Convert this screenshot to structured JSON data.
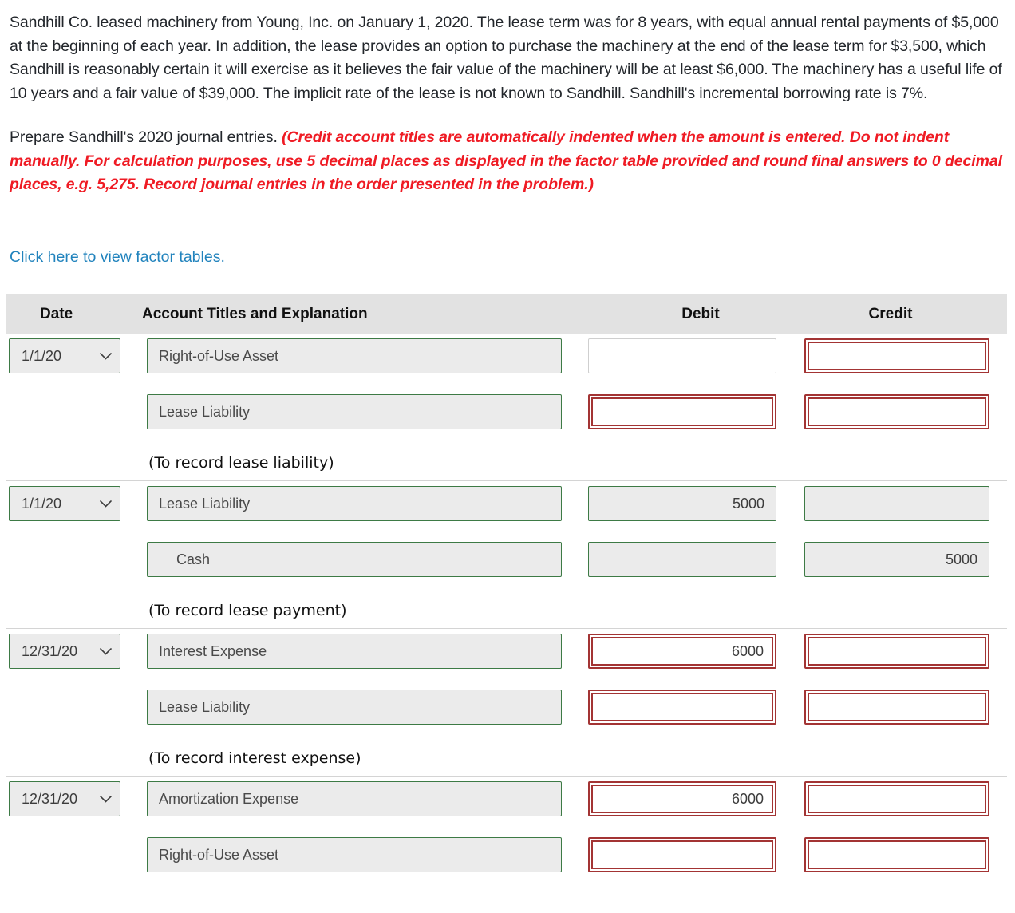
{
  "problem": {
    "paragraph1": "Sandhill Co. leased machinery from Young, Inc. on January 1, 2020. The lease term was for 8 years, with equal annual rental payments of $5,000 at the beginning of each year. In addition, the lease provides an option to purchase the machinery at the end of the lease term for $3,500, which Sandhill is reasonably certain it will exercise as it believes the fair value of the machinery will be at least $6,000. The machinery has a useful life of 10 years and a fair value of $39,000. The implicit rate of the lease is not known to Sandhill. Sandhill's incremental borrowing rate is 7%.",
    "instruction_lead": "Prepare Sandhill's 2020 journal entries. ",
    "instruction_emphasis": "(Credit account titles are automatically indented when the amount is entered. Do not indent manually. For calculation purposes, use 5 decimal places as displayed in the factor table provided and round final answers to 0 decimal places, e.g. 5,275. Record journal entries in the order presented in the problem.)",
    "factor_link": "Click here to view factor tables."
  },
  "colors": {
    "emphasis_red": "#ef1b24",
    "link_blue": "#2183bd",
    "border_green": "#3d7a45",
    "border_red": "#a33434",
    "field_gray": "#ebebeb",
    "header_gray": "#e2e2e2"
  },
  "table": {
    "headers": {
      "date": "Date",
      "account": "Account Titles and Explanation",
      "debit": "Debit",
      "credit": "Credit"
    },
    "blocks": [
      {
        "date": "1/1/20",
        "date_state": "green",
        "rows": [
          {
            "account": "Right-of-Use Asset",
            "account_state": "green",
            "indent": false,
            "debit": "",
            "debit_state": "plain",
            "credit": "",
            "credit_state": "red"
          },
          {
            "account": "Lease Liability",
            "account_state": "green",
            "indent": false,
            "debit": "",
            "debit_state": "red",
            "credit": "",
            "credit_state": "red"
          }
        ],
        "explanation": "(To record lease liability)"
      },
      {
        "date": "1/1/20",
        "date_state": "green",
        "rows": [
          {
            "account": "Lease Liability",
            "account_state": "green",
            "indent": false,
            "debit": "5000",
            "debit_state": "green",
            "credit": "",
            "credit_state": "green"
          },
          {
            "account": "Cash",
            "account_state": "green",
            "indent": true,
            "debit": "",
            "debit_state": "green",
            "credit": "5000",
            "credit_state": "green"
          }
        ],
        "explanation": "(To record lease payment)"
      },
      {
        "date": "12/31/20",
        "date_state": "green",
        "rows": [
          {
            "account": "Interest Expense",
            "account_state": "green",
            "indent": false,
            "debit": "6000",
            "debit_state": "red",
            "credit": "",
            "credit_state": "red"
          },
          {
            "account": "Lease Liability",
            "account_state": "green",
            "indent": false,
            "debit": "",
            "debit_state": "red",
            "credit": "",
            "credit_state": "red"
          }
        ],
        "explanation": "(To record interest expense)"
      },
      {
        "date": "12/31/20",
        "date_state": "green",
        "rows": [
          {
            "account": "Amortization Expense",
            "account_state": "green",
            "indent": false,
            "debit": "6000",
            "debit_state": "red",
            "credit": "",
            "credit_state": "red"
          },
          {
            "account": "Right-of-Use Asset",
            "account_state": "green",
            "indent": false,
            "debit": "",
            "debit_state": "red",
            "credit": "",
            "credit_state": "red"
          }
        ],
        "explanation": ""
      }
    ]
  }
}
